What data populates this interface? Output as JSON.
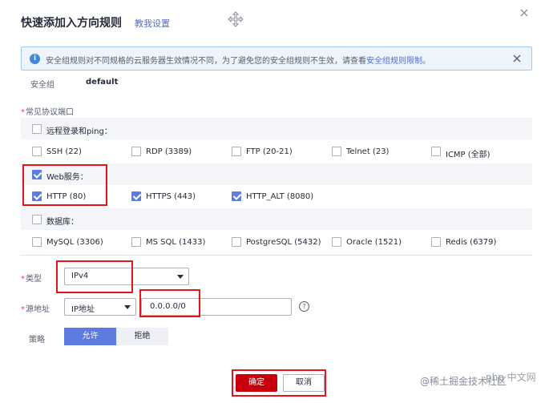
{
  "dialog": {
    "title": "快速添加入方向规则",
    "help_link": "教我设置"
  },
  "info": {
    "text": "安全组规则对不同规格的云服务器生效情况不同，为了避免您的安全组规则不生效，请查看",
    "link": "安全组规则限制",
    "suffix": "。"
  },
  "security_group": {
    "label": "安全组",
    "value": "default"
  },
  "ports": {
    "label": "常见协议端口",
    "required_mark": "*",
    "groups": [
      {
        "label": "远程登录和ping：",
        "checked": false,
        "options": [
          {
            "label": "SSH (22)",
            "checked": false
          },
          {
            "label": "RDP (3389)",
            "checked": false
          },
          {
            "label": "FTP (20-21)",
            "checked": false
          },
          {
            "label": "Telnet (23)",
            "checked": false
          },
          {
            "label": "ICMP (全部)",
            "checked": false
          }
        ]
      },
      {
        "label": "Web服务：",
        "checked": true,
        "options": [
          {
            "label": "HTTP (80)",
            "checked": true
          },
          {
            "label": "HTTPS (443)",
            "checked": true
          },
          {
            "label": "HTTP_ALT (8080)",
            "checked": true
          }
        ]
      },
      {
        "label": "数据库：",
        "checked": false,
        "options": [
          {
            "label": "MySQL (3306)",
            "checked": false
          },
          {
            "label": "MS SQL (1433)",
            "checked": false
          },
          {
            "label": "PostgreSQL (5432)",
            "checked": false
          },
          {
            "label": "Oracle (1521)",
            "checked": false
          },
          {
            "label": "Redis (6379)",
            "checked": false
          }
        ]
      }
    ]
  },
  "type": {
    "label": "类型",
    "value": "IPv4"
  },
  "source": {
    "label": "源地址",
    "type_value": "IP地址",
    "address": "0.0.0.0/0"
  },
  "policy": {
    "label": "策略",
    "allow": "允许",
    "deny": "拒绝"
  },
  "footer": {
    "ok": "确定",
    "cancel": "取消"
  },
  "watermark": "@稀土掘金技术社区",
  "watermark_logo": "php 中文网",
  "colors": {
    "primary": "#5e7ce0",
    "danger_button": "#c7000b",
    "highlight_box": "#e8141c",
    "link": "#526ecc"
  }
}
